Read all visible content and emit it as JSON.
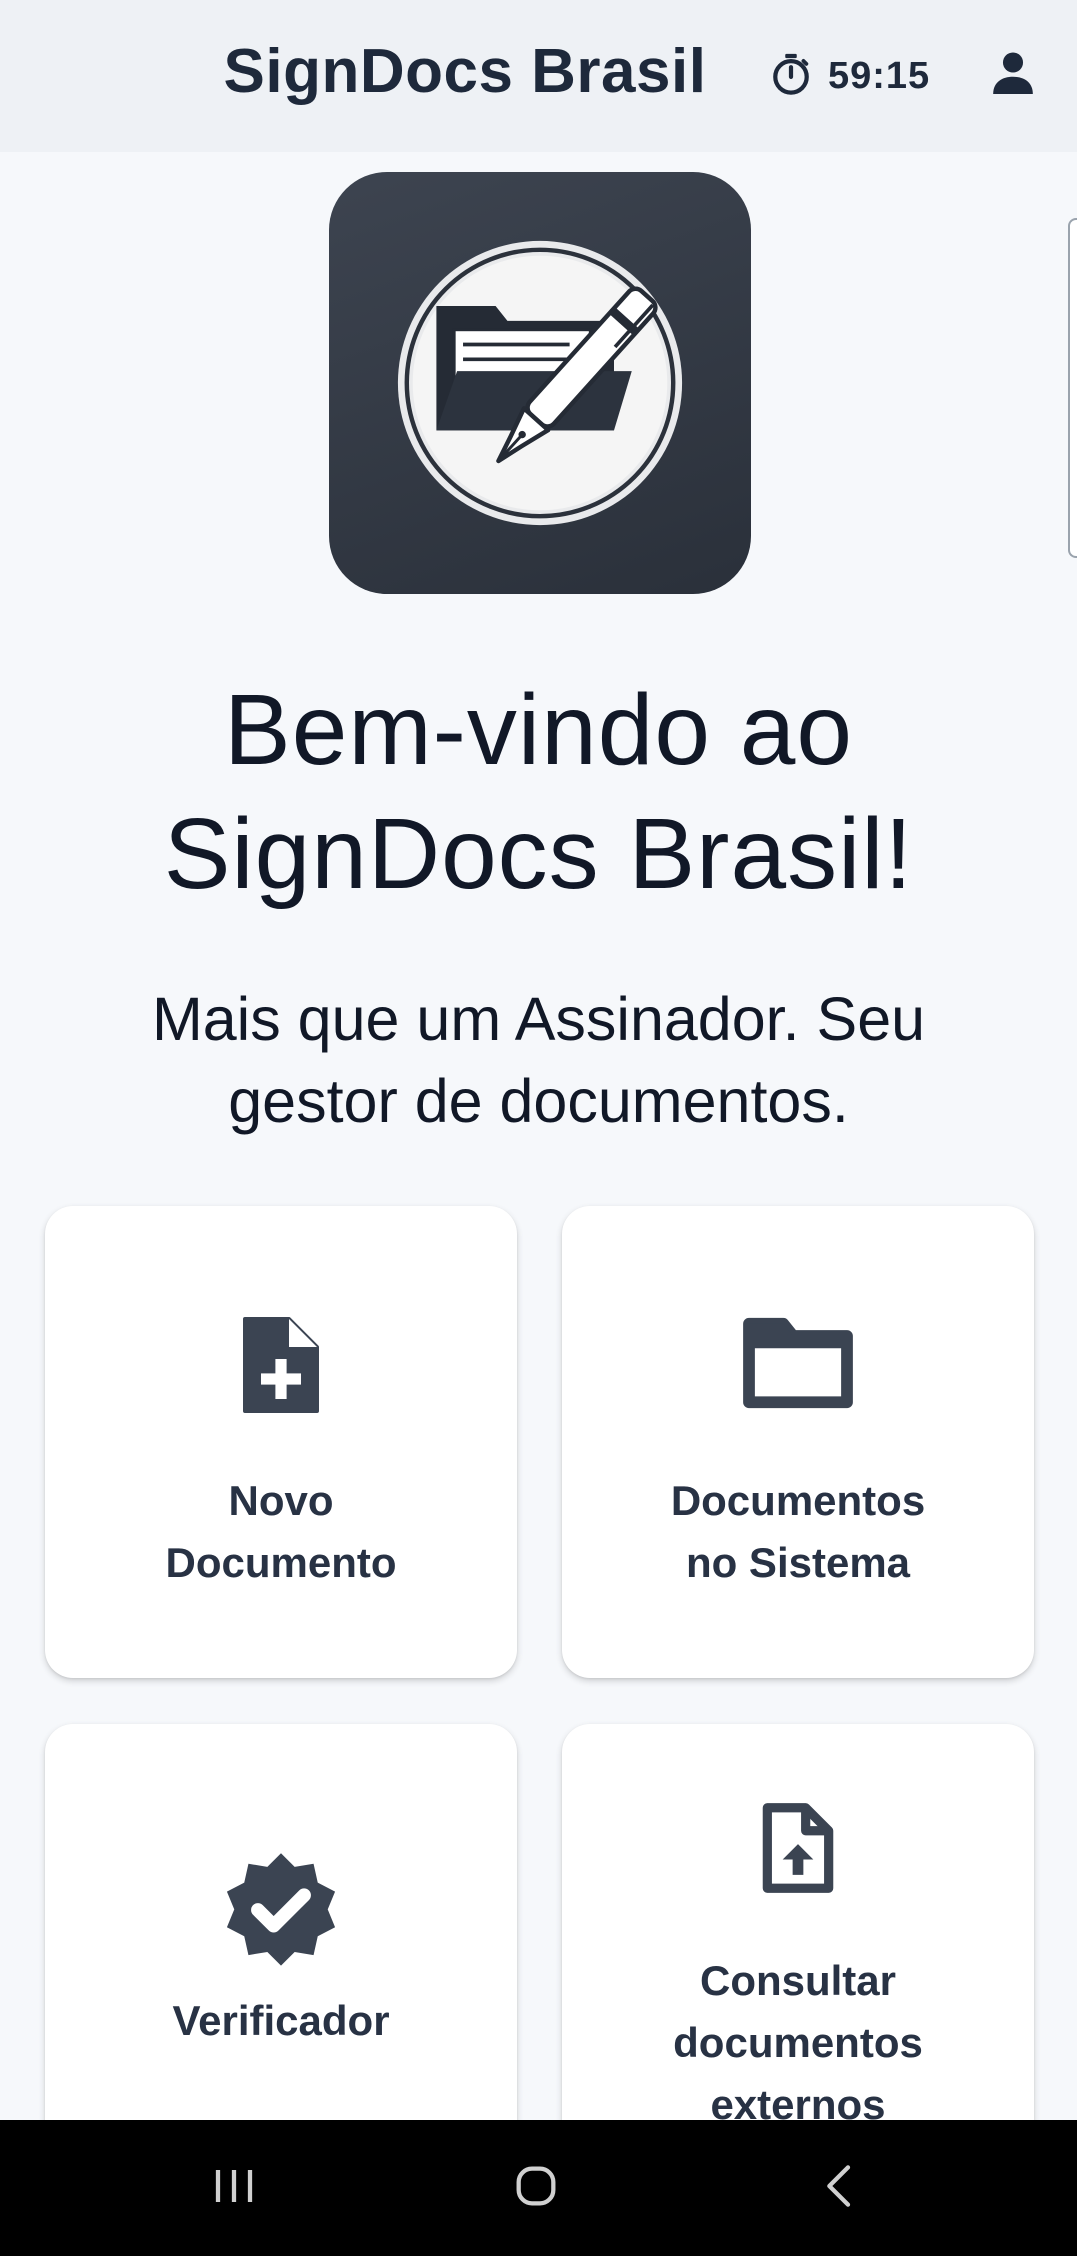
{
  "header": {
    "title": "SignDocs Brasil",
    "timer": "59:15",
    "timer_icon": "stopwatch-icon",
    "user_icon": "person-icon"
  },
  "logo": {
    "icon": "folder-pen-logo",
    "background_color": "#323945"
  },
  "welcome": {
    "line1": "Bem-vindo ao",
    "line2": "SignDocs Brasil!"
  },
  "tagline": {
    "line1": "Mais que um Assinador. Seu",
    "line2": "gestor de documentos."
  },
  "cards": [
    {
      "icon": "file-plus-icon",
      "label_line1": "Novo",
      "label_line2": "Documento"
    },
    {
      "icon": "folder-icon",
      "label_line1": "Documentos",
      "label_line2": "no Sistema"
    },
    {
      "icon": "verified-badge-icon",
      "label_line1": "Verificador"
    },
    {
      "icon": "file-upload-icon",
      "label_line1": "Consultar",
      "label_line2": "documentos",
      "label_line3": "externos"
    }
  ],
  "system_nav": {
    "recent_icon": "recent-apps-icon",
    "home_icon": "home-icon",
    "back_icon": "back-icon"
  },
  "colors": {
    "text_dark": "#1e293b",
    "icon_gray": "#3b4452",
    "background": "#f6f8fb",
    "header_background": "#eef1f5"
  }
}
